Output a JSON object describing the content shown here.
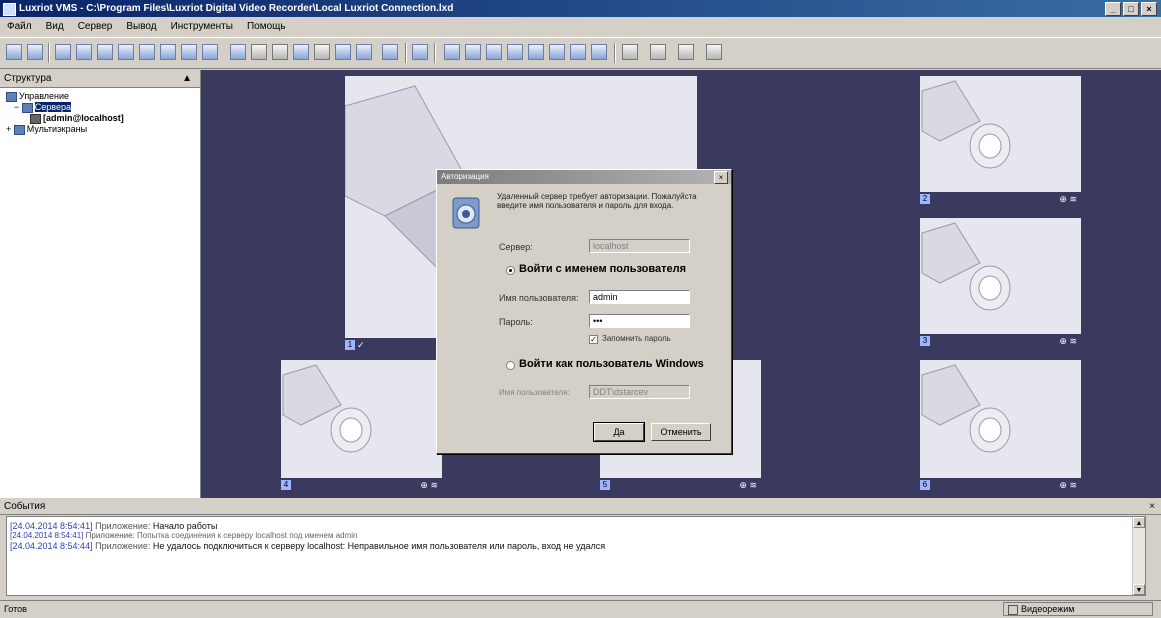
{
  "window": {
    "title": "Luxriot VMS - C:\\Program Files\\Luxriot Digital Video Recorder\\Local Luxriot Connection.lxd",
    "controls": [
      "_",
      "□",
      "×"
    ]
  },
  "menubar": {
    "items": [
      "Файл",
      "Вид",
      "Сервер",
      "Вывод",
      "Инструменты",
      "Помощь"
    ]
  },
  "toolbar": {
    "icons": [
      "open-icon",
      "save-icon",
      "layout-1-icon",
      "layout-2-icon",
      "layout-3-icon",
      "camera-icon",
      "record-icon",
      "snapshot-icon",
      "alarm-icon",
      "fullscreen-icon",
      "ptz-icon",
      "zoom-icon",
      "settings-icon",
      "help-icon",
      "user-icon",
      "grid-1x1-icon",
      "grid-2x2-icon",
      "grid-3x3-icon",
      "grid-4x4-icon",
      "grid-1plus5-icon",
      "grid-1plus7-icon",
      "grid-2plus8-icon",
      "grid-3plus4-icon",
      "screen-icon",
      "sequence-icon",
      "map-icon",
      "monitor-icon"
    ]
  },
  "left_panel": {
    "title": "Структура",
    "tree": [
      {
        "label": "Управление",
        "level": 0
      },
      {
        "label": "Сервера",
        "level": 1
      },
      {
        "label": "[admin@localhost]",
        "level": 2
      },
      {
        "label": "Мультиэкраны",
        "level": 0
      }
    ]
  },
  "video_tiles": [
    {
      "id": "center",
      "num": "1",
      "label": "",
      "extra": ""
    },
    {
      "id": "right-1",
      "num": "2",
      "label": "",
      "extra": "⊕ ≋"
    },
    {
      "id": "right-2",
      "num": "3",
      "label": "",
      "extra": "⊕ ≋"
    },
    {
      "id": "bottom-1",
      "num": "4",
      "label": "",
      "extra": "⊕ ≋"
    },
    {
      "id": "bottom-2",
      "num": "5",
      "label": "",
      "extra": "⊕ ≋"
    },
    {
      "id": "right-3",
      "num": "6",
      "label": "",
      "extra": "⊕ ≋"
    }
  ],
  "dialog": {
    "title": "Авторизация",
    "close": "×",
    "description": "Удаленный сервер требует авторизации. Пожалуйста введите имя пользователя и пароль для входа.",
    "server_label": "Сервер:",
    "server_value": "localhost",
    "option_user": "Войти с именем пользователя",
    "username_label": "Имя пользователя:",
    "username_value": "admin",
    "password_label": "Пароль:",
    "password_value": "•••",
    "remember_label": "Запомнить пароль",
    "option_windows": "Войти как пользователь Windows",
    "windows_user_label": "Имя пользователя:",
    "windows_user_value": "DDT\\dstarcev",
    "ok_label": "Да",
    "cancel_label": "Отменить"
  },
  "events": {
    "title": "События",
    "close": "×",
    "lines": [
      {
        "time": "[24.04.2014 8:54:41]",
        "source": "Приложение:",
        "text": "Начало работы"
      },
      {
        "time": "[24.04.2014 8:54:41]",
        "source": "Приложение:",
        "text": "Попытка соединения к серверу localhost под именем admin"
      },
      {
        "time": "[24.04.2014 8:54:44]",
        "source": "Приложение:",
        "text": "Не удалось подключиться к серверу localhost: Неправильное имя пользователя или пароль, вход не удался"
      }
    ]
  },
  "statusbar": {
    "left": "Готов",
    "right": "Видеорежим"
  },
  "colors": {
    "video_bg": "#3a3a5e",
    "tile_bg": "#e6e6ef",
    "title_gradient_start": "#0a246a",
    "log_time": "#2b3fbf"
  }
}
